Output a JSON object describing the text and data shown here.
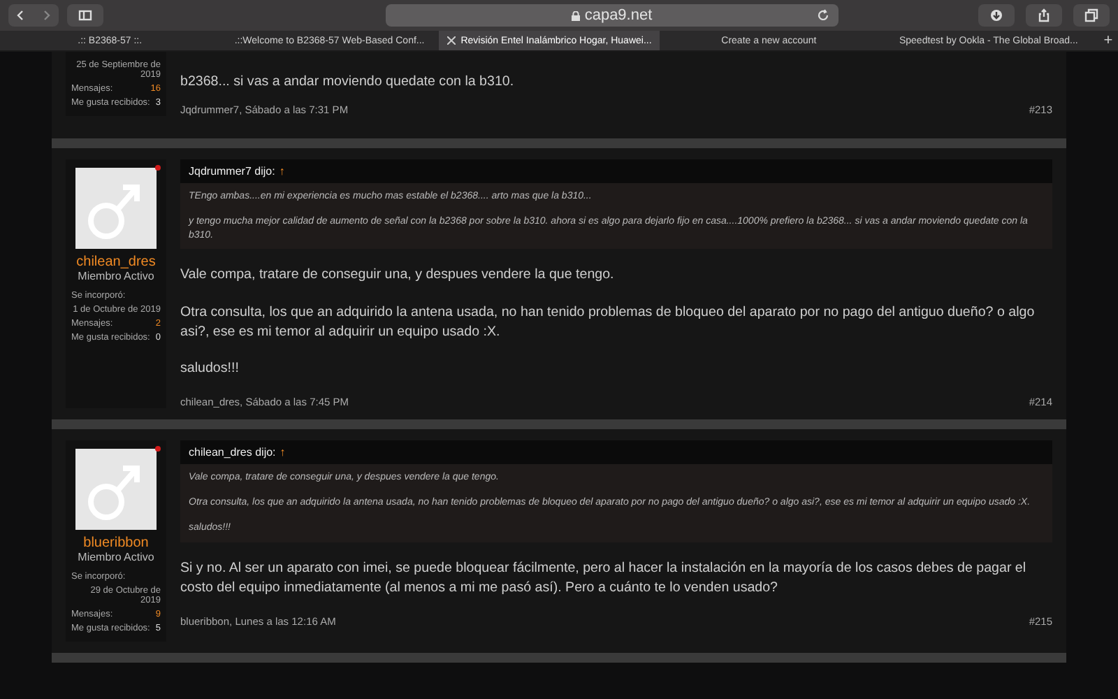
{
  "browser": {
    "address": "capa9.net",
    "tabs": [
      {
        "label": ".:: B2368-57 ::.",
        "selected": false
      },
      {
        "label": ".::Welcome to B2368-57 Web-Based Conf...",
        "selected": false
      },
      {
        "label": "Revisión Entel Inalámbrico Hogar, Huawei...",
        "selected": true
      },
      {
        "label": "Create a new account",
        "selected": false
      },
      {
        "label": "Speedtest by Ookla - The Global Broad...",
        "selected": false
      }
    ],
    "new_tab": "+"
  },
  "posts": [
    {
      "joined": "25 de Septiembre de 2019",
      "stats": [
        {
          "kind": "messages",
          "label": "Mensajes:",
          "value": "16"
        },
        {
          "kind": "likes",
          "label": "Me gusta recibidos:",
          "value": "3"
        }
      ],
      "message": [
        "b2368... si vas a andar moviendo quedate con la b310."
      ],
      "footer": "Jqdrummer7, Sábado a las 7:31 PM",
      "number": "#213"
    },
    {
      "author": "chilean_dres",
      "role": "Miembro Activo",
      "online": true,
      "joined_label": "Se incorporó:",
      "joined": "1 de Octubre de 2019",
      "stats": [
        {
          "kind": "messages",
          "label": "Mensajes:",
          "value": "2"
        },
        {
          "kind": "likes",
          "label": "Me gusta recibidos:",
          "value": "0"
        }
      ],
      "quote": {
        "author": "Jqdrummer7 dijo:",
        "arrow": "↑",
        "paragraphs": [
          "TEngo ambas....en mi experiencia es mucho mas estable el b2368.... arto mas que la b310...",
          "y tengo mucha mejor calidad de aumento de señal con la b2368 por sobre la b310. ahora si es algo para dejarlo fijo en casa....1000% prefiero la b2368... si vas a andar moviendo quedate con la b310."
        ]
      },
      "message": [
        "Vale compa, tratare de conseguir una, y despues vendere la que tengo.",
        "Otra consulta, los que an adquirido la antena usada, no han tenido problemas de bloqueo del aparato por no pago del antiguo dueño? o algo asi?, ese es mi temor al adquirir un equipo usado :X.",
        "saludos!!!"
      ],
      "footer": "chilean_dres, Sábado a las 7:45 PM",
      "number": "#214"
    },
    {
      "author": "blueribbon",
      "role": "Miembro Activo",
      "online": true,
      "joined_label": "Se incorporó:",
      "joined": "29 de Octubre de 2019",
      "stats": [
        {
          "kind": "messages",
          "label": "Mensajes:",
          "value": "9"
        },
        {
          "kind": "likes",
          "label": "Me gusta recibidos:",
          "value": "5"
        }
      ],
      "quote": {
        "author": "chilean_dres dijo:",
        "arrow": "↑",
        "paragraphs": [
          "Vale compa, tratare de conseguir una, y despues vendere la que tengo.",
          "Otra consulta, los que an adquirido la antena usada, no han tenido problemas de bloqueo del aparato por no pago del antiguo dueño? o algo asi?, ese es mi temor al adquirir un equipo usado :X.",
          "saludos!!!"
        ]
      },
      "message": [
        "Si y no. Al ser un aparato con imei, se puede bloquear fácilmente, pero al hacer la instalación en la mayoría de los casos debes de pagar el costo del equipo inmediatamente (al menos a mi me pasó así). Pero a cuánto te lo venden usado?"
      ],
      "footer": "blueribbon, Lunes a las 12:16 AM",
      "number": "#215"
    }
  ]
}
